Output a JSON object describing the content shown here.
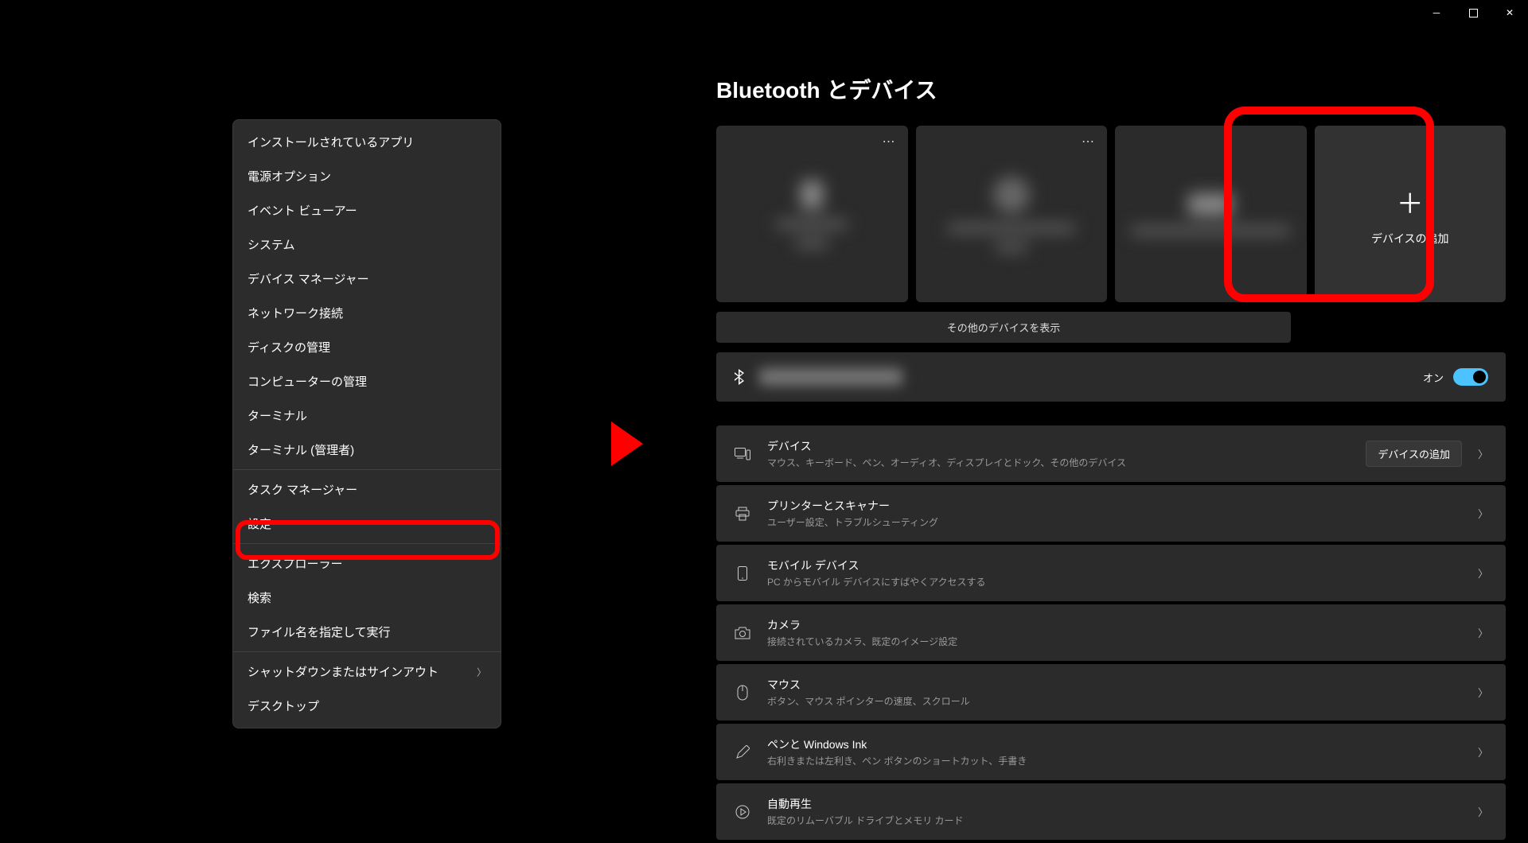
{
  "titlebar": {
    "minimize": "—",
    "maximize": "▢",
    "close": "✕"
  },
  "context_menu": {
    "items_group1": [
      "インストールされているアプリ",
      "電源オプション",
      "イベント ビューアー",
      "システム",
      "デバイス マネージャー",
      "ネットワーク接続",
      "ディスクの管理",
      "コンピューターの管理",
      "ターミナル",
      "ターミナル (管理者)"
    ],
    "items_group2": [
      "タスク マネージャー",
      "設定"
    ],
    "items_group3": [
      "エクスプローラー",
      "検索",
      "ファイル名を指定して実行"
    ],
    "items_group4": [
      {
        "label": "シャットダウンまたはサインアウト",
        "chevron": true
      },
      {
        "label": "デスクトップ",
        "chevron": false
      }
    ]
  },
  "settings": {
    "page_title": "Bluetooth とデバイス",
    "add_device_tile": "デバイスの追加",
    "show_more": "その他のデバイスを表示",
    "bluetooth": {
      "on_label": "オン"
    },
    "rows": [
      {
        "title": "デバイス",
        "desc": "マウス、キーボード、ペン、オーディオ、ディスプレイとドック、その他のデバイス",
        "button": "デバイスの追加"
      },
      {
        "title": "プリンターとスキャナー",
        "desc": "ユーザー設定、トラブルシューティング"
      },
      {
        "title": "モバイル デバイス",
        "desc": "PC からモバイル デバイスにすばやくアクセスする"
      },
      {
        "title": "カメラ",
        "desc": "接続されているカメラ、既定のイメージ設定"
      },
      {
        "title": "マウス",
        "desc": "ボタン、マウス ポインターの速度、スクロール"
      },
      {
        "title": "ペンと Windows Ink",
        "desc": "右利きまたは左利き、ペン ボタンのショートカット、手書き"
      },
      {
        "title": "自動再生",
        "desc": "既定のリムーバブル ドライブとメモリ カード"
      }
    ]
  }
}
